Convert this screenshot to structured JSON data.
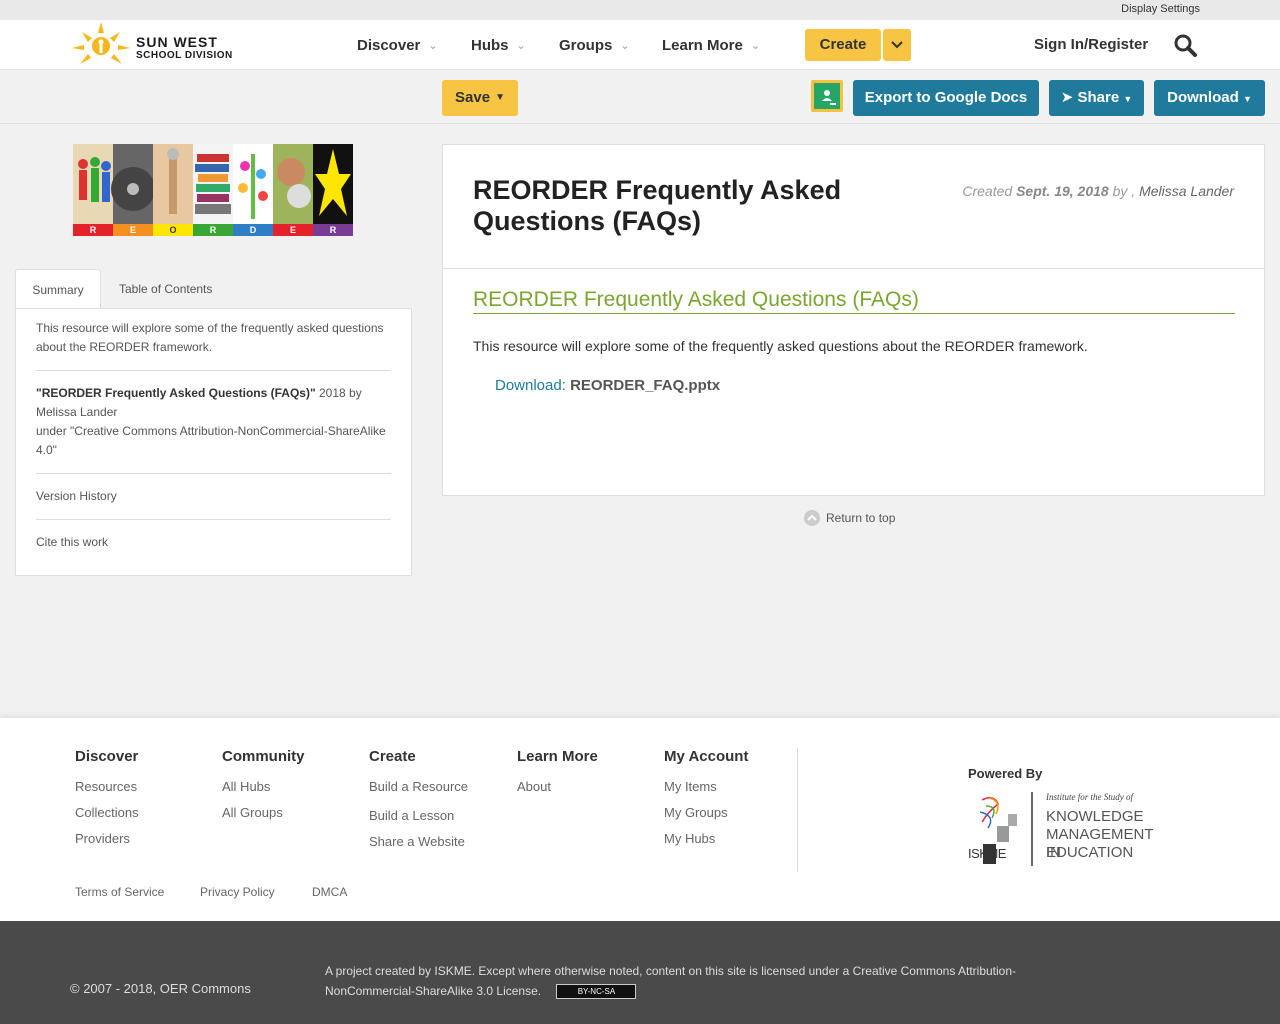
{
  "util": {
    "display_settings": "Display Settings"
  },
  "header": {
    "logo_line1": "SUN WEST",
    "logo_line2": "SCHOOL DIVISION",
    "nav": [
      "Discover",
      "Hubs",
      "Groups",
      "Learn More"
    ],
    "create_label": "Create",
    "signin_label": "Sign In/Register"
  },
  "toolbar": {
    "save_label": "Save",
    "export_label": "Export to Google Docs",
    "share_label": "Share",
    "download_label": "Download"
  },
  "banner": {
    "letters": [
      "R",
      "E",
      "O",
      "R",
      "D",
      "E",
      "R"
    ]
  },
  "tabs": {
    "summary": "Summary",
    "toc": "Table of Contents"
  },
  "summary": {
    "description": "This resource will explore some of the frequently asked questions about the REORDER framework.",
    "license_title": "\"REORDER Frequently Asked Questions (FAQs)\"",
    "license_year_by": "2018 by",
    "license_author": "Melissa Lander",
    "license_under": "under \"Creative Commons Attribution-NonCommercial-ShareAlike 4.0\"",
    "version_history": "Version History",
    "cite": "Cite this work"
  },
  "resource": {
    "title": "REORDER Frequently Asked Questions (FAQs)",
    "created_label": "Created",
    "created_date": "Sept. 19, 2018",
    "by_label": "by ,",
    "author": "Melissa Lander",
    "subheading": "REORDER Frequently Asked Questions (FAQs)",
    "description": "This resource will explore some of the frequently asked questions about the REORDER framework.",
    "download_label": "Download:",
    "download_file": "REORDER_FAQ.pptx"
  },
  "return_to_top": "Return to top",
  "footer": {
    "columns": [
      {
        "heading": "Discover",
        "links": [
          "Resources",
          "Collections",
          "Providers"
        ]
      },
      {
        "heading": "Community",
        "links": [
          "All Hubs",
          "All Groups"
        ]
      },
      {
        "heading": "Create",
        "links": [
          "Build a Resource",
          "Build a Lesson",
          "Share a Website"
        ]
      },
      {
        "heading": "Learn More",
        "links": [
          "About"
        ]
      },
      {
        "heading": "My Account",
        "links": [
          "My Items",
          "My Groups",
          "My Hubs"
        ]
      }
    ],
    "powered_by": "Powered By",
    "iskme_small": "Institute for the Study of",
    "iskme_line1": "KNOWLEDGE",
    "iskme_line2": "MANAGEMENT IN",
    "iskme_line3": "EDUCATION",
    "iskme_mark": "ISKME",
    "legal": [
      "Terms of Service",
      "Privacy Policy",
      "DMCA"
    ]
  },
  "bottom": {
    "copyright": "© 2007 - 2018, OER Commons",
    "project_text": "A project created by ISKME. Except where otherwise noted, content on this site is licensed under a Creative Commons Attribution-NonCommercial-ShareAlike 3.0 License.",
    "cc_badge": "BY-NC-SA"
  },
  "colors": {
    "accent_yellow": "#f7c444",
    "button_blue": "#1f7a9c",
    "heading_green": "#7aa52e",
    "footer_dark": "#4a4a4a"
  }
}
